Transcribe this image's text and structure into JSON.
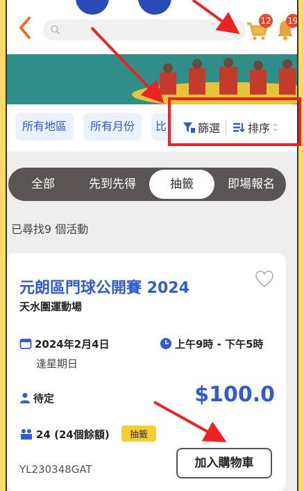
{
  "header": {
    "search_placeholder": "",
    "cart_count": "12",
    "notification_count": "19"
  },
  "filters": {
    "chips": [
      "所有地區",
      "所有月份",
      "比"
    ],
    "filter_label": "篩選",
    "sort_label": "排序"
  },
  "tabs": [
    "全部",
    "先到先得",
    "抽籤",
    "即場報名"
  ],
  "active_tab_index": 2,
  "results_text": "已尋找9 個活動",
  "event": {
    "title": "元朗區門球公開賽 2024",
    "venue": "天水圍運動場",
    "date": "2024年2月4日",
    "weekday": "逢星期日",
    "time": "上午9時 - 下午5時",
    "status": "待定",
    "price": "$100.0",
    "quota": "24 (24個餘額)",
    "method_tag": "抽籤",
    "code": "YL230348GAT",
    "add_to_cart_label": "加入購物車"
  },
  "colors": {
    "accent_blue": "#2f5bd3",
    "badge_red": "#e34a26",
    "annotation_red": "#e22",
    "tag_yellow": "#f8cc33"
  }
}
